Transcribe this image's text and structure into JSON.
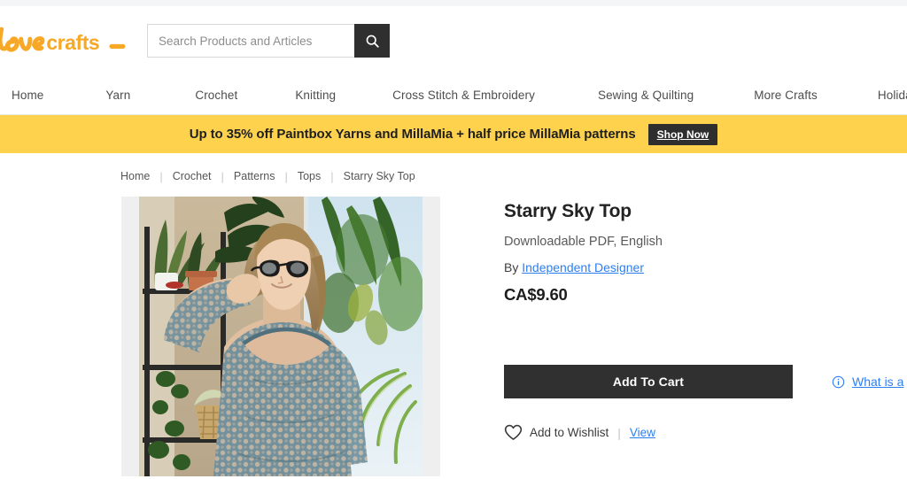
{
  "brand": {
    "name": "lovecrafts",
    "script_part": "love",
    "bold_part": "crafts",
    "color": "#f7a827"
  },
  "search": {
    "placeholder": "Search Products and Articles",
    "value": "",
    "button_icon": "search-icon"
  },
  "nav": {
    "items": [
      {
        "label": "Home"
      },
      {
        "label": "Yarn"
      },
      {
        "label": "Crochet"
      },
      {
        "label": "Knitting"
      },
      {
        "label": "Cross Stitch & Embroidery"
      },
      {
        "label": "Sewing & Quilting"
      },
      {
        "label": "More Crafts"
      },
      {
        "label": "Holidays"
      }
    ]
  },
  "promo": {
    "text": "Up to 35% off Paintbox Yarns and MillaMia + half price MillaMia patterns",
    "button_label": "Shop Now",
    "background": "#ffd24d",
    "button_background": "#2e2e2e"
  },
  "breadcrumb": {
    "items": [
      {
        "label": "Home"
      },
      {
        "label": "Crochet"
      },
      {
        "label": "Patterns"
      },
      {
        "label": "Tops"
      },
      {
        "label": "Starry Sky Top"
      }
    ],
    "separator": "|"
  },
  "product": {
    "title": "Starry Sky Top",
    "format": "Downloadable PDF, English",
    "by_prefix": "By",
    "designer": "Independent Designer",
    "price": "CA$9.60",
    "image_alt": "Woman wearing a teal crocheted mesh top surrounded by houseplants"
  },
  "actions": {
    "add_to_cart": "Add To Cart",
    "what_is_link": "What is a",
    "info_icon": "info-circle-icon",
    "wishlist_icon": "heart-icon",
    "wishlist_label": "Add to Wishlist",
    "wishlist_separator": "|",
    "view_label": "View"
  },
  "colors": {
    "link": "#2d7ff0",
    "dark_button": "#303030",
    "accent": "#f7a827"
  }
}
